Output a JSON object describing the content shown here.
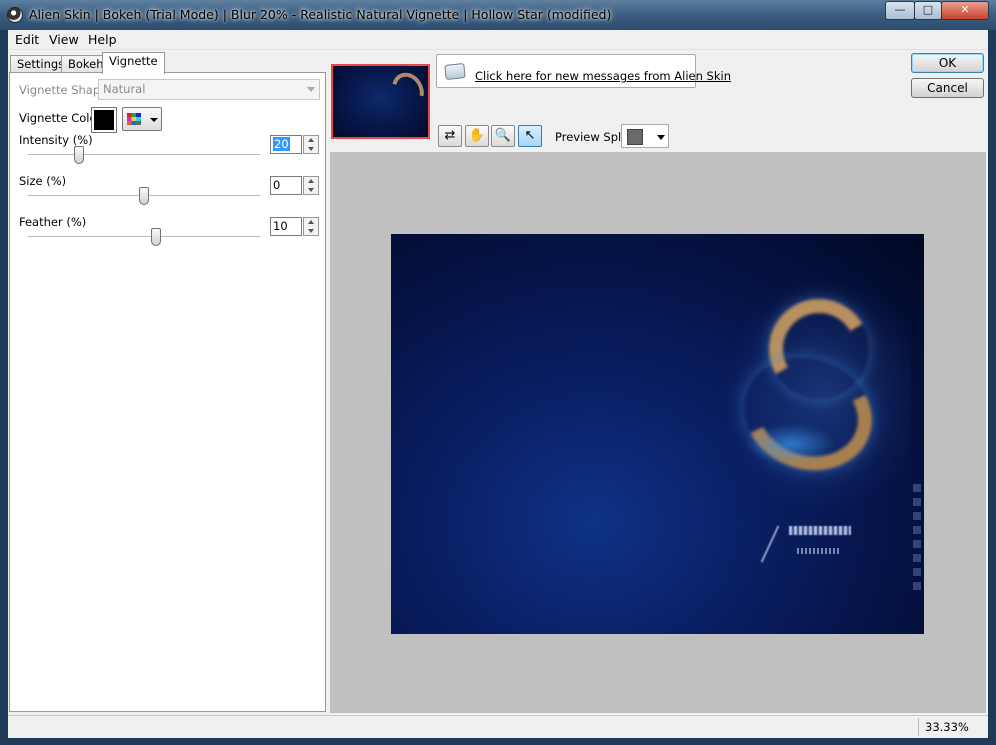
{
  "window": {
    "title": "Alien Skin | Bokeh (Trial Mode) | Blur 20% - Realistic Natural Vignette | Hollow Star (modified)",
    "minimize_glyph": "—",
    "maximize_glyph": "□",
    "close_glyph": "✕"
  },
  "menu": [
    "Edit",
    "View",
    "Help"
  ],
  "tabs": [
    {
      "label": "Settings",
      "active": false
    },
    {
      "label": "Bokeh",
      "active": false
    },
    {
      "label": "Vignette",
      "active": true
    }
  ],
  "vignette": {
    "shape_label": "Vignette Shape:",
    "shape_value": "Natural",
    "color_label": "Vignette Color",
    "color_value": "#000000",
    "intensity": {
      "label": "Intensity (%)",
      "value": "20",
      "slider_fraction": 0.22
    },
    "size": {
      "label": "Size (%)",
      "value": "0",
      "slider_fraction": 0.5
    },
    "feather": {
      "label": "Feather (%)",
      "value": "10",
      "slider_fraction": 0.55
    }
  },
  "messages": {
    "link_text": "Click here for new messages from Alien Skin"
  },
  "toolbar": {
    "tools": [
      {
        "name": "compare-icon",
        "glyph": "⇄",
        "active": false
      },
      {
        "name": "hand-icon",
        "glyph": "✋",
        "active": false
      },
      {
        "name": "zoom-icon",
        "glyph": "🔍",
        "active": false
      },
      {
        "name": "pointer-icon",
        "glyph": "↖",
        "active": true
      }
    ],
    "preview_split_label": "Preview Split:"
  },
  "buttons": {
    "ok": "OK",
    "cancel": "Cancel"
  },
  "status": {
    "zoom": "33.33%"
  },
  "colors": {
    "thumbnail_border": "#e84848",
    "selection": "#3399ff"
  }
}
